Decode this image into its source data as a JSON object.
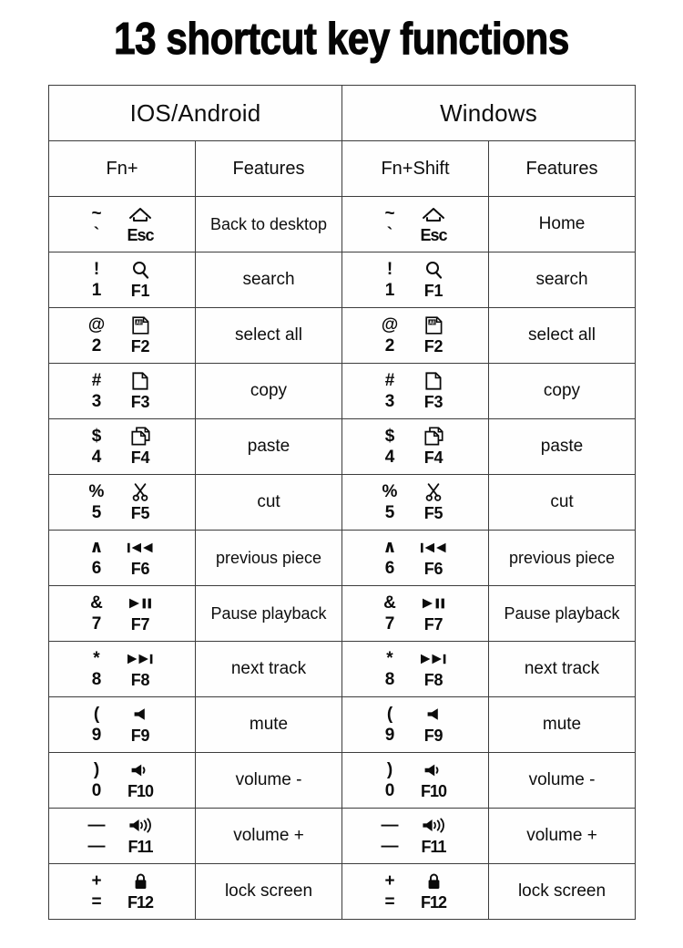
{
  "page": {
    "title": "13 shortcut key functions",
    "background_color": "#ffffff",
    "text_color": "#0e0e0e",
    "border_color": "#3c3c3c"
  },
  "table": {
    "group_headers": [
      {
        "label": "IOS/Android",
        "span": 2
      },
      {
        "label": "Windows",
        "span": 2
      }
    ],
    "sub_headers": [
      "Fn+",
      "Features",
      "Fn+Shift",
      "Features"
    ],
    "rows": [
      {
        "key": {
          "top_left": "~",
          "top_right_icon": "home-icon",
          "bottom_left": "`",
          "bottom_right": "Esc"
        },
        "ios_feature": "Back to desktop",
        "win_feature": "Home"
      },
      {
        "key": {
          "top_left": "!",
          "top_right_icon": "search-icon",
          "bottom_left": "1",
          "bottom_right": "F1"
        },
        "ios_feature": "search",
        "win_feature": "search"
      },
      {
        "key": {
          "top_left": "@",
          "top_right_icon": "select-all-icon",
          "bottom_left": "2",
          "bottom_right": "F2"
        },
        "ios_feature": "select all",
        "win_feature": "select all"
      },
      {
        "key": {
          "top_left": "#",
          "top_right_icon": "copy-icon",
          "bottom_left": "3",
          "bottom_right": "F3"
        },
        "ios_feature": "copy",
        "win_feature": "copy"
      },
      {
        "key": {
          "top_left": "$",
          "top_right_icon": "paste-icon",
          "bottom_left": "4",
          "bottom_right": "F4"
        },
        "ios_feature": "paste",
        "win_feature": "paste"
      },
      {
        "key": {
          "top_left": "%",
          "top_right_icon": "scissors-icon",
          "bottom_left": "5",
          "bottom_right": "F5"
        },
        "ios_feature": "cut",
        "win_feature": "cut"
      },
      {
        "key": {
          "top_left": "∧",
          "top_right_icon": "previous-track-icon",
          "bottom_left": "6",
          "bottom_right": "F6"
        },
        "ios_feature": "previous piece",
        "win_feature": "previous piece"
      },
      {
        "key": {
          "top_left": "&",
          "top_right_icon": "play-pause-icon",
          "bottom_left": "7",
          "bottom_right": "F7"
        },
        "ios_feature": "Pause playback",
        "win_feature": "Pause playback"
      },
      {
        "key": {
          "top_left": "*",
          "top_right_icon": "next-track-icon",
          "bottom_left": "8",
          "bottom_right": "F8"
        },
        "ios_feature": "next track",
        "win_feature": "next track"
      },
      {
        "key": {
          "top_left": "(",
          "top_right_icon": "volume-mute-icon",
          "bottom_left": "9",
          "bottom_right": "F9"
        },
        "ios_feature": "mute",
        "win_feature": "mute"
      },
      {
        "key": {
          "top_left": ")",
          "top_right_icon": "volume-down-icon",
          "bottom_left": "0",
          "bottom_right": "F10"
        },
        "ios_feature": "volume -",
        "win_feature": "volume -"
      },
      {
        "key": {
          "top_left": "—",
          "top_right_icon": "volume-up-icon",
          "bottom_left": "—",
          "bottom_right": "F11"
        },
        "ios_feature": "volume +",
        "win_feature": "volume +"
      },
      {
        "key": {
          "top_left": "+",
          "top_right_icon": "lock-icon",
          "bottom_left": "=",
          "bottom_right": "F12"
        },
        "ios_feature": "lock screen",
        "win_feature": "lock screen"
      }
    ]
  }
}
